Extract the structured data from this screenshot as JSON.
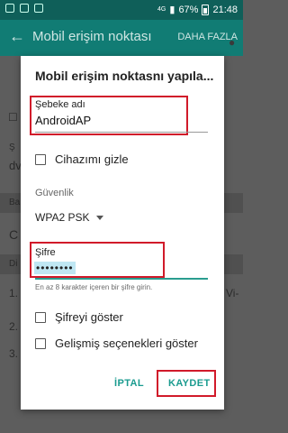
{
  "status": {
    "network": "4G",
    "battery": "67%",
    "time": "21:48"
  },
  "appbar": {
    "title": "Mobil erişim noktası",
    "more": "DAHA FAZLA"
  },
  "background": {
    "left_fragments": [
      "Ş",
      "dv",
      "Ba",
      "C",
      "Di",
      "1.",
      "2.",
      "3."
    ],
    "right_fragments": [
      "Vi-"
    ]
  },
  "dialog": {
    "title": "Mobil erişim noktasnı yapıla...",
    "network_name": {
      "label": "Şebeke adı",
      "value": "AndroidAP"
    },
    "hide_device": {
      "label": "Cihazımı gizle",
      "checked": false
    },
    "security": {
      "label": "Güvenlik",
      "value": "WPA2 PSK",
      "icon": "dropdown-arrow"
    },
    "password": {
      "label": "Şifre",
      "value": "••••••••",
      "helper": "En az 8 karakter içeren bir şifre girin."
    },
    "show_password": {
      "label": "Şifreyi göster",
      "checked": false
    },
    "advanced": {
      "label": "Gelişmiş seçenekleri göster",
      "checked": false
    },
    "buttons": {
      "cancel": "İPTAL",
      "save": "KAYDET"
    }
  },
  "colors": {
    "accent": "#1a9b8f",
    "highlight_box": "#d11a2a",
    "appbar": "#117c74",
    "statusbar": "#0f5f59"
  }
}
